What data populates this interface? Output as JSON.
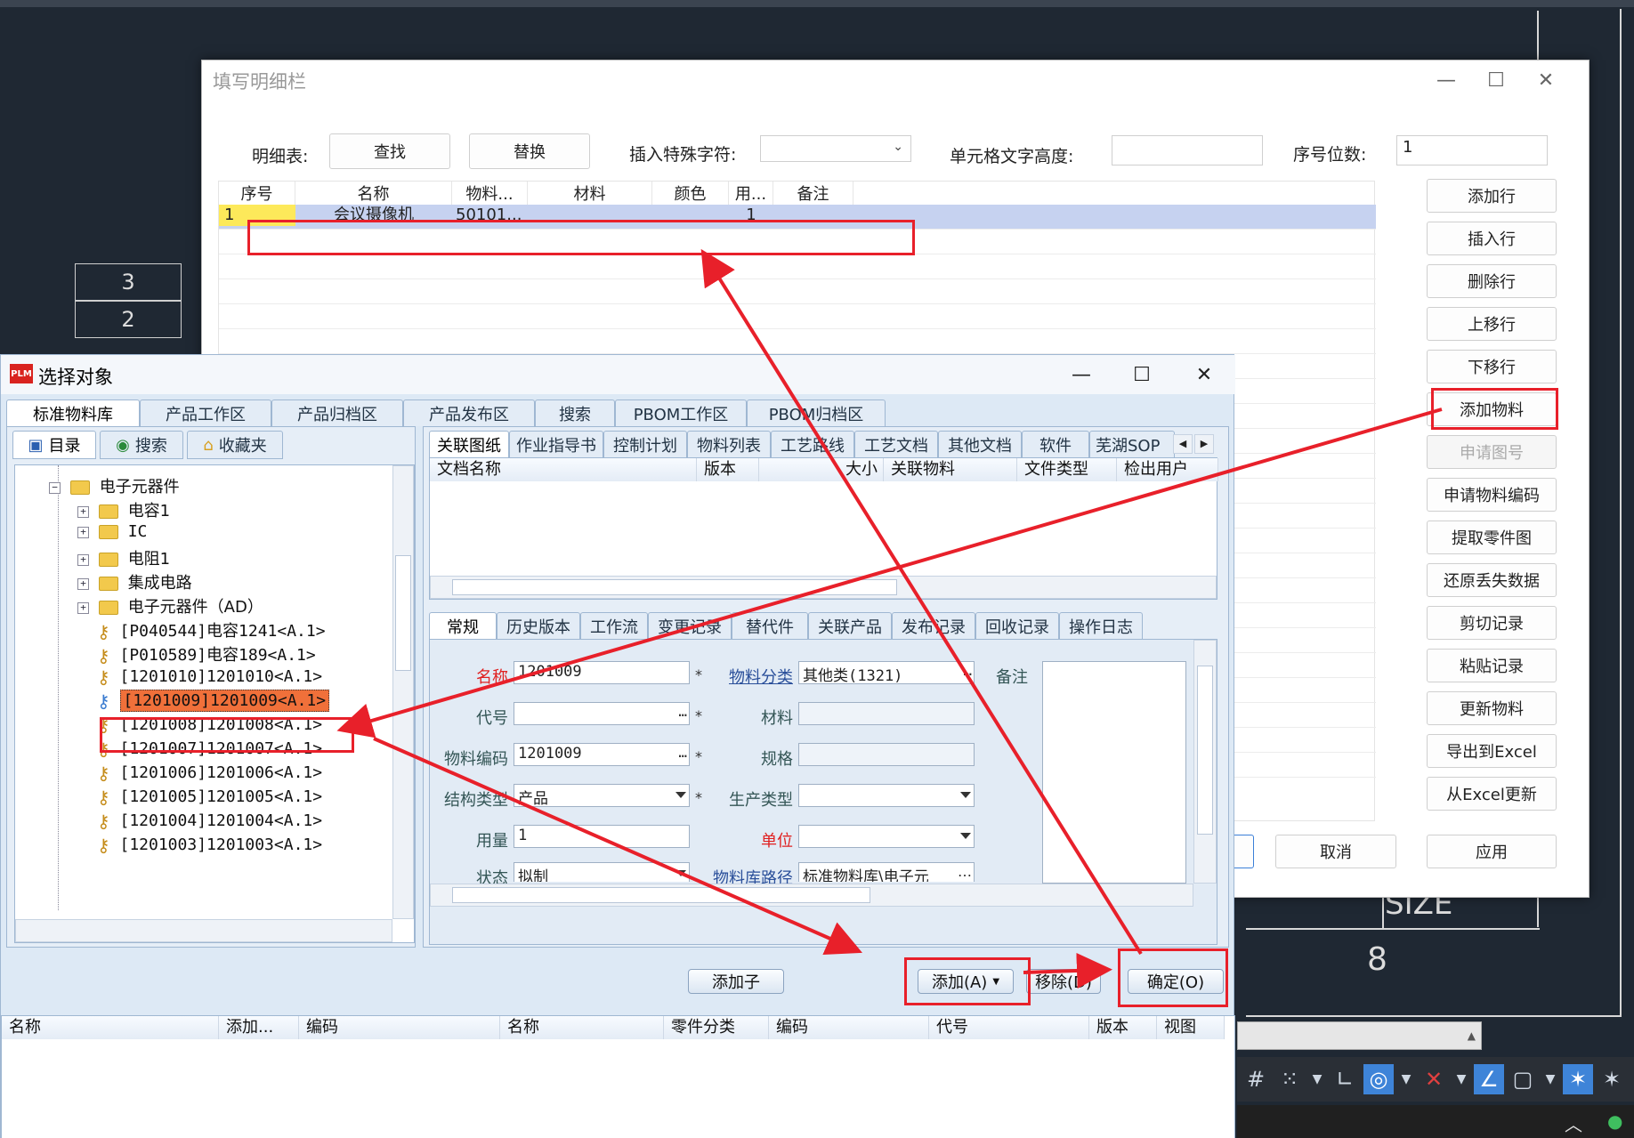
{
  "cad": {
    "cells": [
      "3",
      "2"
    ],
    "size_label": "SIZE",
    "number": "8"
  },
  "detail_dialog": {
    "title": "填写明细栏",
    "table_label": "明细表:",
    "find_btn": "查找",
    "replace_btn": "替换",
    "special_char_label": "插入特殊字符:",
    "cell_height_label": "单元格文字高度:",
    "seq_digits_label": "序号位数:",
    "seq_digits_value": "1",
    "columns": [
      "序号",
      "名称",
      "物料...",
      "材料",
      "颜色",
      "用...",
      "备注"
    ],
    "row": [
      "1",
      "会议摄像机",
      "50101...",
      "",
      "",
      "1",
      ""
    ],
    "side_buttons": [
      "添加行",
      "插入行",
      "删除行",
      "上移行",
      "下移行",
      "添加物料",
      "申请图号",
      "申请物料编码",
      "提取零件图",
      "还原丢失数据",
      "剪切记录",
      "粘贴记录",
      "更新物料",
      "导出到Excel",
      "从Excel更新"
    ],
    "cancel_btn": "取消",
    "apply_btn": "应用"
  },
  "select_dialog": {
    "title": "选择对象",
    "tabs": [
      "标准物料库",
      "产品工作区",
      "产品归档区",
      "产品发布区",
      "搜索",
      "PBOM工作区",
      "PBOM归档区"
    ],
    "left_tabs": [
      "目录",
      "搜索",
      "收藏夹"
    ],
    "tree": [
      {
        "label": "电子元器件",
        "kind": "folder-open"
      },
      {
        "label": "电容1",
        "kind": "folder"
      },
      {
        "label": "IC",
        "kind": "folder"
      },
      {
        "label": "电阻1",
        "kind": "folder"
      },
      {
        "label": "集成电路",
        "kind": "folder"
      },
      {
        "label": "电子元器件（AD）",
        "kind": "folder"
      },
      {
        "label": "[P040544]电容1241<A.1>",
        "kind": "item"
      },
      {
        "label": "[P010589]电容189<A.1>",
        "kind": "item"
      },
      {
        "label": "[1201010]1201010<A.1>",
        "kind": "item"
      },
      {
        "label": "[1201009]1201009<A.1>",
        "kind": "item-selected"
      },
      {
        "label": "[1201008]1201008<A.1>",
        "kind": "item"
      },
      {
        "label": "[1201007]1201007<A.1>",
        "kind": "item"
      },
      {
        "label": "[1201006]1201006<A.1>",
        "kind": "item"
      },
      {
        "label": "[1201005]1201005<A.1>",
        "kind": "item"
      },
      {
        "label": "[1201004]1201004<A.1>",
        "kind": "item"
      },
      {
        "label": "[1201003]1201003<A.1>",
        "kind": "item"
      }
    ],
    "doc_tabs": [
      "关联图纸",
      "作业指导书",
      "控制计划",
      "物料列表",
      "工艺路线",
      "工艺文档",
      "其他文档",
      "软件",
      "芜湖SOP"
    ],
    "doc_columns": [
      "文档名称",
      "版本",
      "大小",
      "关联物料",
      "文件类型",
      "检出用户"
    ],
    "prop_tabs": [
      "常规",
      "历史版本",
      "工作流",
      "变更记录",
      "替代件",
      "关联产品",
      "发布记录",
      "回收记录",
      "操作日志"
    ],
    "fields": {
      "name_label": "名称",
      "name_value": "1201009",
      "code_label": "代号",
      "code_value": "",
      "matcode_label": "物料编码",
      "matcode_value": "1201009",
      "struct_label": "结构类型",
      "struct_value": "产品",
      "qty_label": "用量",
      "qty_value": "1",
      "status_label": "状态",
      "status_value": "拟制",
      "cat_label": "物料分类",
      "cat_value": "其他类(1321)",
      "material_label": "材料",
      "material_value": "",
      "spec_label": "规格",
      "spec_value": "",
      "prodtype_label": "生产类型",
      "prodtype_value": "",
      "unit_label": "单位",
      "unit_value": "",
      "path_label": "物料库路径",
      "path_value": "标准物料库\\电子元",
      "remark_label": "备注"
    },
    "add_child_btn": "添加子",
    "add_btn": "添加(A)",
    "remove_btn": "移除(D)",
    "ok_btn": "确定(O)",
    "bottom_columns": [
      "名称",
      "添加...",
      "编码",
      "名称",
      "零件分类",
      "编码",
      "代号",
      "版本",
      "视图"
    ]
  },
  "colors": {
    "accent_red": "#e8202a",
    "selected_item": "#f0703a",
    "dialog_bg": "#dde9f5"
  }
}
